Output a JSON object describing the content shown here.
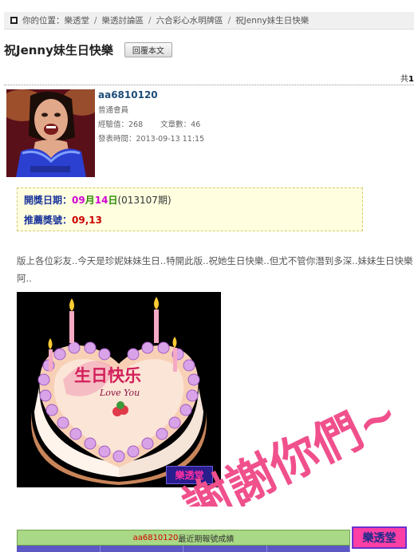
{
  "breadcrumb": {
    "prefix": "你的位置：",
    "items": [
      "樂透堂",
      "樂透討論區",
      "六合彩心水明牌區",
      "祝Jenny妹生日快樂"
    ]
  },
  "post": {
    "title": "祝Jenny妹生日快樂",
    "reply_button": "回覆本文",
    "page_total_prefix": "共",
    "page_total_num": "1"
  },
  "user": {
    "name": "aa6810120",
    "rank": "普通會員",
    "exp_label": "經驗值：",
    "exp_value": "268",
    "articles_label": "文章數：",
    "articles_value": "46",
    "posted_label": "發表時間：",
    "posted_value": "2013-09-13 11:15"
  },
  "lotto": {
    "date_label": "開獎日期：",
    "month": "09",
    "month_unit": "月",
    "day": "14",
    "day_unit": "日",
    "period": "(013107期)",
    "numbers_label": "推薦獎號：",
    "numbers": "09,13"
  },
  "body_text": "版上各位彩友..今天是珍妮妹妹生日..特開此版..祝她生日快樂..但尤不管你潛到多深..妹妹生日快樂阿..",
  "image": {
    "cake_text_cn": "生日快乐",
    "cake_text_en": "Love You",
    "watermark": "樂透堂",
    "overlay_line1": "謝謝你們~"
  },
  "stats": {
    "username": "aa6810120",
    "header_suffix": "最近期報號成績"
  },
  "corner_badge": "樂透堂",
  "colors": {
    "link_blue": "#1d4d7a",
    "lotto_magenta": "#d200d2",
    "lotto_red": "#cc0000",
    "overlay_pink": "#f0508c",
    "table_green": "#a9d886",
    "badge_pink": "#ff3fa4"
  }
}
